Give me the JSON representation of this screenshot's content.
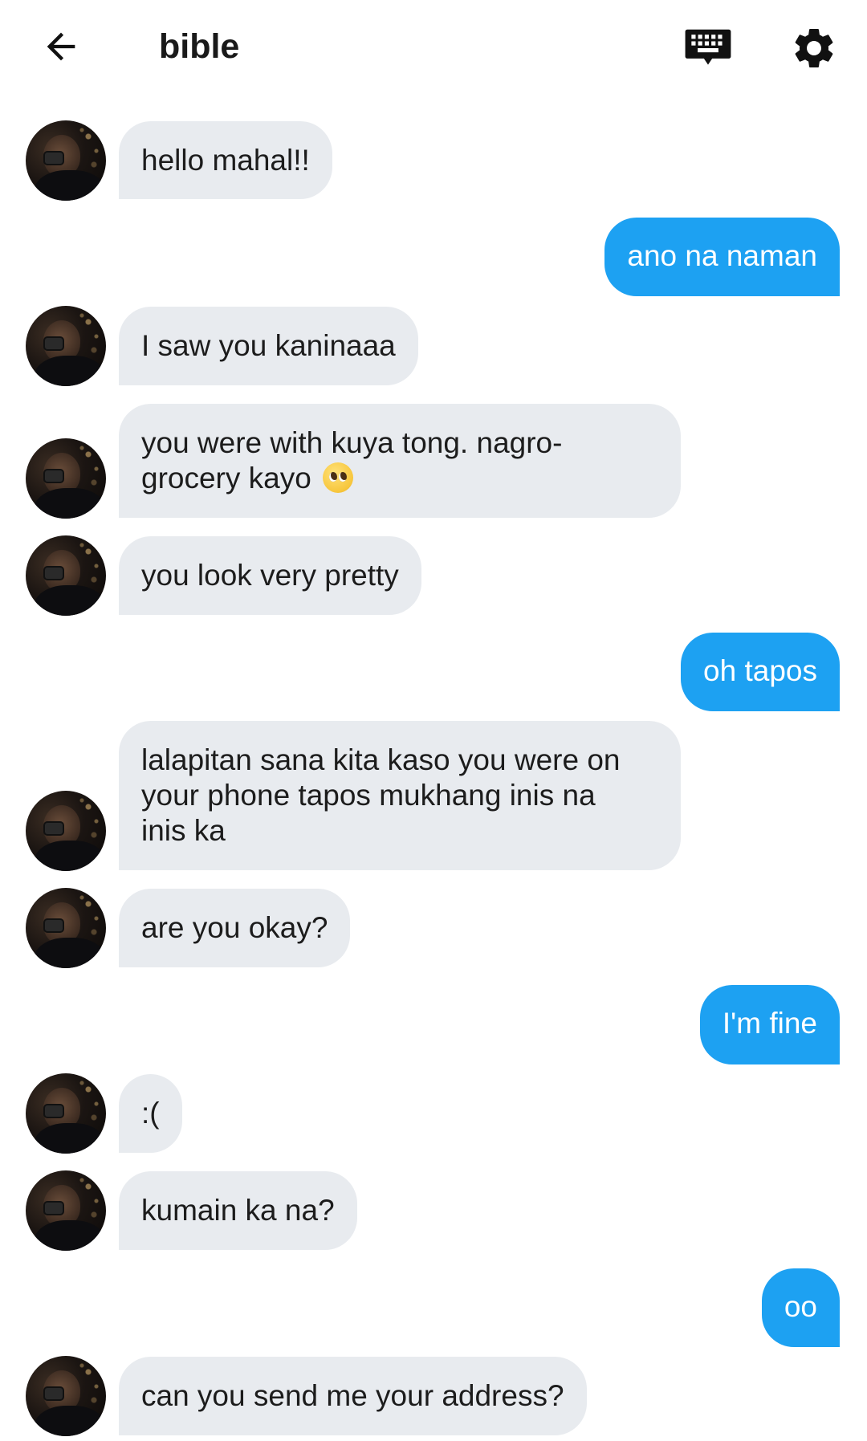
{
  "header": {
    "title": "bible",
    "icons": {
      "back": "arrow-left-icon",
      "keyboard": "keyboard-icon",
      "settings": "gear-icon"
    }
  },
  "colors": {
    "outgoing_bubble": "#1da1f2",
    "incoming_bubble": "#e8ebef",
    "background": "#ffffff"
  },
  "messages": [
    {
      "side": "in",
      "text": "hello mahal!!"
    },
    {
      "side": "out",
      "text": "ano na naman"
    },
    {
      "side": "in",
      "text": "I saw you kaninaaa"
    },
    {
      "side": "in",
      "text": "you were with kuya tong. nagro-\ngrocery kayo",
      "emoji": "pleading-face-emoji"
    },
    {
      "side": "in",
      "text": "you look very pretty"
    },
    {
      "side": "out",
      "text": "oh tapos"
    },
    {
      "side": "in",
      "text": "lalapitan sana kita kaso you were on\nyour phone tapos mukhang inis na\ninis ka"
    },
    {
      "side": "in",
      "text": "are you okay?"
    },
    {
      "side": "out",
      "text": "I'm fine"
    },
    {
      "side": "in",
      "text": ":("
    },
    {
      "side": "in",
      "text": "kumain ka na?"
    },
    {
      "side": "out",
      "text": "oo"
    },
    {
      "side": "in",
      "text": "can you send me your address?"
    }
  ]
}
